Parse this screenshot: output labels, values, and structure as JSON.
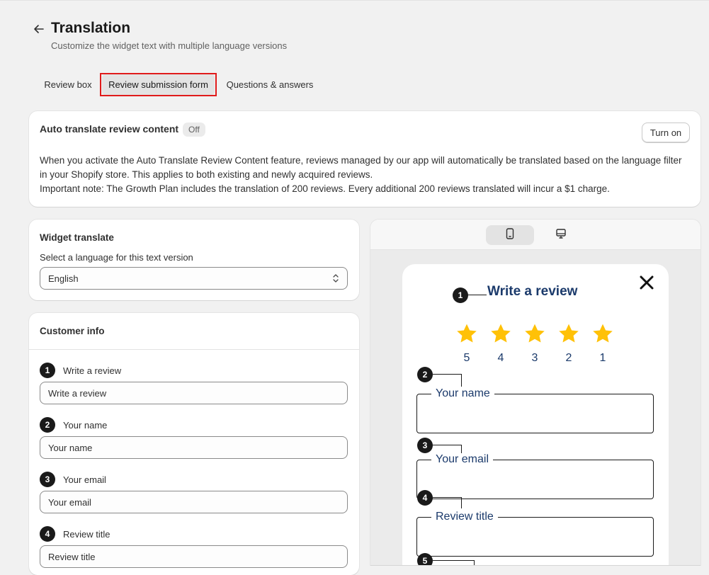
{
  "header": {
    "title": "Translation",
    "subtitle": "Customize the widget text with multiple language versions"
  },
  "tabs": [
    {
      "label": "Review box",
      "selected": false
    },
    {
      "label": "Review submission form",
      "selected": true
    },
    {
      "label": "Questions & answers",
      "selected": false
    }
  ],
  "auto_translate": {
    "title": "Auto translate review content",
    "status": "Off",
    "button": "Turn on",
    "description_1": "When you activate the Auto Translate Review Content feature, reviews managed by our app will automatically be translated based on the language filter in your Shopify store. This applies to both existing and newly acquired reviews.",
    "description_2": "Important note: The Growth Plan includes the translation of 200 reviews. Every additional 200 reviews translated will incur a $1 charge."
  },
  "widget_translate": {
    "title": "Widget translate",
    "language_label": "Select a language for this text version",
    "language_value": "English"
  },
  "customer_info": {
    "title": "Customer info",
    "fields": [
      {
        "num": "1",
        "label": "Write a review",
        "value": "Write a review"
      },
      {
        "num": "2",
        "label": "Your name",
        "value": "Your name"
      },
      {
        "num": "3",
        "label": "Your email",
        "value": "Your email"
      },
      {
        "num": "4",
        "label": "Review title",
        "value": "Review title"
      }
    ]
  },
  "preview": {
    "views": [
      "mobile-icon",
      "desktop-icon"
    ],
    "active_view": "mobile",
    "modal": {
      "num": "1",
      "title": "Write a review",
      "stars": [
        "5",
        "4",
        "3",
        "2",
        "1"
      ],
      "star_color": "#ffc107",
      "fields": [
        {
          "num": "2",
          "label": "Your name"
        },
        {
          "num": "3",
          "label": "Your email"
        },
        {
          "num": "4",
          "label": "Review title"
        }
      ],
      "next_num": "5"
    }
  },
  "colors": {
    "accent_highlight": "#e01b1b",
    "preview_text": "#1b3a6b",
    "background": "#f1f1f1"
  }
}
